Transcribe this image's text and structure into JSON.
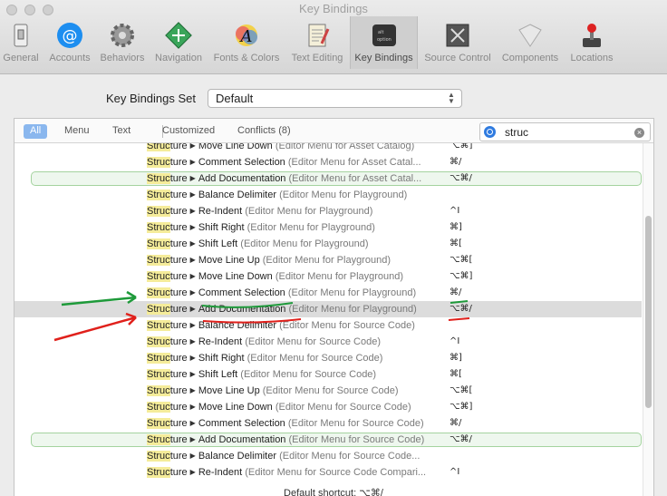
{
  "window": {
    "title": "Key Bindings"
  },
  "toolbar": {
    "items": [
      {
        "label": "General",
        "icon": "switch-icon"
      },
      {
        "label": "Accounts",
        "icon": "at-icon"
      },
      {
        "label": "Behaviors",
        "icon": "gear-icon"
      },
      {
        "label": "Navigation",
        "icon": "navigation-icon"
      },
      {
        "label": "Fonts & Colors",
        "icon": "color-a-icon"
      },
      {
        "label": "Text Editing",
        "icon": "notepad-icon"
      },
      {
        "label": "Key Bindings",
        "icon": "keyboard-key-icon"
      },
      {
        "label": "Source Control",
        "icon": "source-control-icon"
      },
      {
        "label": "Components",
        "icon": "shield-icon"
      },
      {
        "label": "Locations",
        "icon": "joystick-icon"
      }
    ],
    "active": "Key Bindings"
  },
  "key_bindings_set": {
    "label": "Key Bindings Set",
    "value": "Default"
  },
  "filter_tabs": [
    "All",
    "Menu",
    "Text",
    "Customized",
    "Conflicts (8)"
  ],
  "selected_tab": "All",
  "search": {
    "value": "struc"
  },
  "rows": [
    {
      "match": "Struc",
      "rest": "ture",
      "action": "Move Line Down",
      "context": "(Editor Menu for Asset Catalog)",
      "key": "⌥⌘]",
      "state": "normal"
    },
    {
      "match": "Struc",
      "rest": "ture",
      "action": "Comment Selection",
      "context": "(Editor Menu for Asset Catal...",
      "key": "⌘/",
      "state": "normal"
    },
    {
      "match": "Struc",
      "rest": "ture",
      "action": "Add Documentation",
      "context": "(Editor Menu for Asset Catal...",
      "key": "⌥⌘/",
      "state": "conflict"
    },
    {
      "match": "Struc",
      "rest": "ture",
      "action": "Balance Delimiter",
      "context": "(Editor Menu for Playground)",
      "key": "",
      "state": "normal"
    },
    {
      "match": "Struc",
      "rest": "ture",
      "action": "Re-Indent",
      "context": "(Editor Menu for Playground)",
      "key": "^I",
      "state": "normal"
    },
    {
      "match": "Struc",
      "rest": "ture",
      "action": "Shift Right",
      "context": "(Editor Menu for Playground)",
      "key": "⌘]",
      "state": "normal"
    },
    {
      "match": "Struc",
      "rest": "ture",
      "action": "Shift Left",
      "context": "(Editor Menu for Playground)",
      "key": "⌘[",
      "state": "normal"
    },
    {
      "match": "Struc",
      "rest": "ture",
      "action": "Move Line Up",
      "context": "(Editor Menu for Playground)",
      "key": "⌥⌘[",
      "state": "normal"
    },
    {
      "match": "Struc",
      "rest": "ture",
      "action": "Move Line Down",
      "context": "(Editor Menu for Playground)",
      "key": "⌥⌘]",
      "state": "normal"
    },
    {
      "match": "Struc",
      "rest": "ture",
      "action": "Comment Selection",
      "context": "(Editor Menu for Playground)",
      "key": "⌘/",
      "state": "normal"
    },
    {
      "match": "Struc",
      "rest": "ture",
      "action": "Add Documentation",
      "context": "(Editor Menu for Playground)",
      "key": "⌥⌘/",
      "state": "selected"
    },
    {
      "match": "Struc",
      "rest": "ture",
      "action": "Balance Delimiter",
      "context": "(Editor Menu for Source Code)",
      "key": "",
      "state": "normal"
    },
    {
      "match": "Struc",
      "rest": "ture",
      "action": "Re-Indent",
      "context": "(Editor Menu for Source Code)",
      "key": "^I",
      "state": "normal"
    },
    {
      "match": "Struc",
      "rest": "ture",
      "action": "Shift Right",
      "context": "(Editor Menu for Source Code)",
      "key": "⌘]",
      "state": "normal"
    },
    {
      "match": "Struc",
      "rest": "ture",
      "action": "Shift Left",
      "context": "(Editor Menu for Source Code)",
      "key": "⌘[",
      "state": "normal"
    },
    {
      "match": "Struc",
      "rest": "ture",
      "action": "Move Line Up",
      "context": "(Editor Menu for Source Code)",
      "key": "⌥⌘[",
      "state": "normal"
    },
    {
      "match": "Struc",
      "rest": "ture",
      "action": "Move Line Down",
      "context": "(Editor Menu for Source Code)",
      "key": "⌥⌘]",
      "state": "normal"
    },
    {
      "match": "Struc",
      "rest": "ture",
      "action": "Comment Selection",
      "context": "(Editor Menu for Source Code)",
      "key": "⌘/",
      "state": "normal"
    },
    {
      "match": "Struc",
      "rest": "ture",
      "action": "Add Documentation",
      "context": "(Editor Menu for Source Code)",
      "key": "⌥⌘/",
      "state": "conflict"
    },
    {
      "match": "Struc",
      "rest": "ture",
      "action": "Balance Delimiter",
      "context": "(Editor Menu for Source Code...",
      "key": "",
      "state": "normal"
    },
    {
      "match": "Struc",
      "rest": "ture",
      "action": "Re-Indent",
      "context": "(Editor Menu for Source Code Compari...",
      "key": "^I",
      "state": "normal"
    }
  ],
  "status": {
    "text": "Default shortcut: ⌥⌘/"
  },
  "colors": {
    "conflict_row": "#a4d39f",
    "selected_row": "#dcdcdc",
    "match_highlight": "#f5ec9a",
    "annotation_green": "#1e9a3a",
    "annotation_red": "#e0201b"
  }
}
